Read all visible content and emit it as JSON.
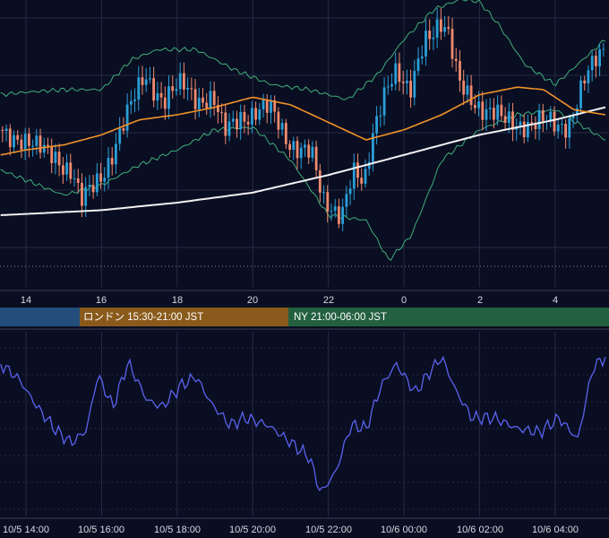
{
  "colors": {
    "background": "#0a0e22",
    "grid": "#262b44",
    "candle_up": "#2a9fd8",
    "candle_down": "#f08a6e",
    "bollinger": "#3fae7a",
    "ma_orange": "#f2922a",
    "ma_white": "#f2f2f2",
    "oscillator": "#5a63f0",
    "session_tokyo": "#234d7a",
    "session_london": "#8a5a1c",
    "session_ny": "#23603f"
  },
  "top_axis_ticks": [
    "14",
    "16",
    "18",
    "20",
    "22",
    "0",
    "2",
    "4"
  ],
  "sessions": [
    {
      "label": ""
    },
    {
      "label": "ロンドン 15:30-21:00 JST"
    },
    {
      "label": "NY 21:00-06:00 JST"
    }
  ],
  "bottom_axis_ticks": [
    "10/5 14:00",
    "10/5 16:00",
    "10/5 18:00",
    "10/5 20:00",
    "10/5 22:00",
    "10/6 00:00",
    "10/6 02:00",
    "10/6 04:00"
  ],
  "chart_data": [
    {
      "type": "candlestick",
      "title": "",
      "x_ticks": [
        "14",
        "16",
        "18",
        "20",
        "22",
        "0",
        "2",
        "4"
      ],
      "x_range_hours": [
        13.33,
        29.33
      ],
      "price_keypoints": [
        [
          13.33,
          0.54
        ],
        [
          13.8,
          0.52
        ],
        [
          14.3,
          0.46
        ],
        [
          14.8,
          0.45
        ],
        [
          15.3,
          0.36
        ],
        [
          15.5,
          0.24
        ],
        [
          16.1,
          0.38
        ],
        [
          16.3,
          0.44
        ],
        [
          16.7,
          0.58
        ],
        [
          17.2,
          0.77
        ],
        [
          17.7,
          0.65
        ],
        [
          18.2,
          0.72
        ],
        [
          18.6,
          0.67
        ],
        [
          19.0,
          0.66
        ],
        [
          19.3,
          0.52
        ],
        [
          19.7,
          0.6
        ],
        [
          20.5,
          0.62
        ],
        [
          21.0,
          0.5
        ],
        [
          21.6,
          0.44
        ],
        [
          21.9,
          0.25
        ],
        [
          22.4,
          0.22
        ],
        [
          22.7,
          0.37
        ],
        [
          23.0,
          0.3
        ],
        [
          23.2,
          0.5
        ],
        [
          23.5,
          0.7
        ],
        [
          23.8,
          0.78
        ],
        [
          24.2,
          0.66
        ],
        [
          24.6,
          0.92
        ],
        [
          25.0,
          0.97
        ],
        [
          25.2,
          0.92
        ],
        [
          25.5,
          0.72
        ],
        [
          25.8,
          0.68
        ],
        [
          26.2,
          0.62
        ],
        [
          26.7,
          0.57
        ],
        [
          27.2,
          0.57
        ],
        [
          27.7,
          0.57
        ],
        [
          28.1,
          0.55
        ],
        [
          28.4,
          0.57
        ],
        [
          28.8,
          0.73
        ],
        [
          29.33,
          0.85
        ]
      ],
      "moving_average_orange_keypoints": [
        [
          13.33,
          0.44
        ],
        [
          14.0,
          0.46
        ],
        [
          15.0,
          0.48
        ],
        [
          16.0,
          0.52
        ],
        [
          17.0,
          0.58
        ],
        [
          18.0,
          0.6
        ],
        [
          19.0,
          0.63
        ],
        [
          20.0,
          0.67
        ],
        [
          21.0,
          0.64
        ],
        [
          22.0,
          0.57
        ],
        [
          23.0,
          0.5
        ],
        [
          24.0,
          0.54
        ],
        [
          25.0,
          0.6
        ],
        [
          26.0,
          0.68
        ],
        [
          27.0,
          0.71
        ],
        [
          27.7,
          0.7
        ],
        [
          28.5,
          0.62
        ],
        [
          29.33,
          0.6
        ]
      ],
      "moving_average_white_keypoints": [
        [
          13.33,
          0.2
        ],
        [
          16.0,
          0.22
        ],
        [
          18.0,
          0.25
        ],
        [
          20.0,
          0.29
        ],
        [
          22.0,
          0.36
        ],
        [
          24.0,
          0.44
        ],
        [
          26.0,
          0.52
        ],
        [
          28.0,
          0.58
        ],
        [
          29.33,
          0.63
        ]
      ],
      "bollinger_band_upper_keypoints": [
        [
          13.33,
          0.68
        ],
        [
          14.0,
          0.69
        ],
        [
          15.0,
          0.7
        ],
        [
          16.0,
          0.7
        ],
        [
          16.8,
          0.82
        ],
        [
          17.5,
          0.86
        ],
        [
          18.5,
          0.86
        ],
        [
          19.5,
          0.78
        ],
        [
          20.5,
          0.72
        ],
        [
          21.5,
          0.7
        ],
        [
          22.5,
          0.66
        ],
        [
          23.3,
          0.76
        ],
        [
          24.0,
          0.9
        ],
        [
          24.8,
          1.02
        ],
        [
          25.5,
          1.06
        ],
        [
          26.0,
          1.05
        ],
        [
          26.5,
          0.96
        ],
        [
          27.2,
          0.8
        ],
        [
          28.0,
          0.72
        ],
        [
          29.33,
          0.9
        ]
      ],
      "bollinger_band_lower_keypoints": [
        [
          13.33,
          0.38
        ],
        [
          14.0,
          0.34
        ],
        [
          15.0,
          0.28
        ],
        [
          16.0,
          0.32
        ],
        [
          17.0,
          0.4
        ],
        [
          18.0,
          0.46
        ],
        [
          19.0,
          0.54
        ],
        [
          20.0,
          0.55
        ],
        [
          21.0,
          0.42
        ],
        [
          22.0,
          0.2
        ],
        [
          23.0,
          0.18
        ],
        [
          23.6,
          0.02
        ],
        [
          24.2,
          0.12
        ],
        [
          25.0,
          0.42
        ],
        [
          26.0,
          0.54
        ],
        [
          27.0,
          0.6
        ],
        [
          28.0,
          0.62
        ],
        [
          29.33,
          0.5
        ]
      ]
    },
    {
      "type": "line",
      "title": "",
      "x_ticks": [
        "10/5 14:00",
        "10/5 16:00",
        "10/5 18:00",
        "10/5 20:00",
        "10/5 22:00",
        "10/6 00:00",
        "10/6 02:00",
        "10/6 04:00"
      ],
      "series_keypoints": [
        [
          13.33,
          0.82
        ],
        [
          13.8,
          0.74
        ],
        [
          14.3,
          0.58
        ],
        [
          14.8,
          0.45
        ],
        [
          15.2,
          0.38
        ],
        [
          15.6,
          0.45
        ],
        [
          15.9,
          0.76
        ],
        [
          16.3,
          0.58
        ],
        [
          16.7,
          0.83
        ],
        [
          17.2,
          0.62
        ],
        [
          17.6,
          0.58
        ],
        [
          18.1,
          0.7
        ],
        [
          18.5,
          0.75
        ],
        [
          18.9,
          0.6
        ],
        [
          19.4,
          0.48
        ],
        [
          19.8,
          0.52
        ],
        [
          20.4,
          0.48
        ],
        [
          20.9,
          0.4
        ],
        [
          21.5,
          0.3
        ],
        [
          21.8,
          0.1
        ],
        [
          22.2,
          0.22
        ],
        [
          22.6,
          0.48
        ],
        [
          23.0,
          0.46
        ],
        [
          23.4,
          0.7
        ],
        [
          23.8,
          0.82
        ],
        [
          24.3,
          0.66
        ],
        [
          24.7,
          0.78
        ],
        [
          25.0,
          0.86
        ],
        [
          25.4,
          0.66
        ],
        [
          25.8,
          0.52
        ],
        [
          26.4,
          0.52
        ],
        [
          27.0,
          0.46
        ],
        [
          27.6,
          0.44
        ],
        [
          28.1,
          0.52
        ],
        [
          28.6,
          0.4
        ],
        [
          29.0,
          0.8
        ],
        [
          29.33,
          0.86
        ]
      ]
    }
  ]
}
